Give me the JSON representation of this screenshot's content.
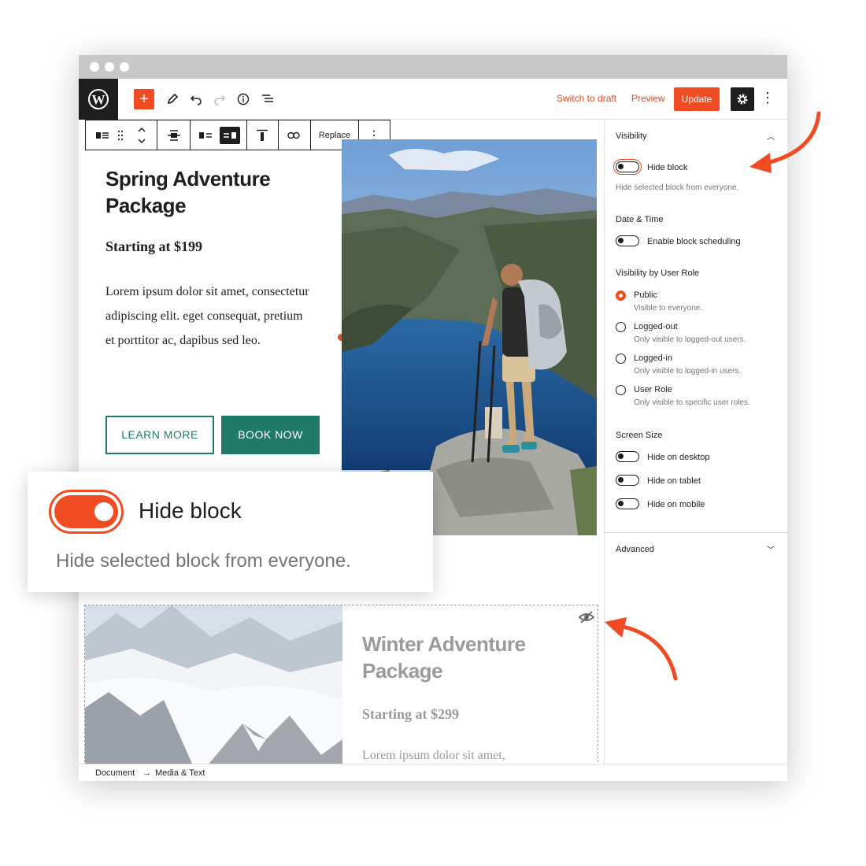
{
  "topbar": {
    "switch_to_draft": "Switch to draft",
    "preview": "Preview",
    "update": "Update",
    "accent": "#f04c23"
  },
  "block_toolbar": {
    "replace": "Replace"
  },
  "content": {
    "title": "Spring Adventure Package",
    "price": "Starting at $199",
    "paragraph": "Lorem ipsum dolor sit amet, consectetur adipiscing elit. eget consequat, pretium et porttitor ac, dapibus sed leo.",
    "learn_more": "LEARN MORE",
    "book_now": "BOOK NOW",
    "button_color": "#1f7a66"
  },
  "hidden_block": {
    "title": "Winter Adventure Package",
    "price": "Starting at $299",
    "paragraph": "Lorem ipsum dolor sit amet,"
  },
  "sidebar": {
    "visibility_heading": "Visibility",
    "hide_block_label": "Hide block",
    "hide_block_help": "Hide selected block from everyone.",
    "date_time_heading": "Date & Time",
    "enable_scheduling_label": "Enable block scheduling",
    "user_role_heading": "Visibility by User Role",
    "roles": [
      {
        "label": "Public",
        "help": "Visible to everyone.",
        "selected": true
      },
      {
        "label": "Logged-out",
        "help": "Only visible to logged-out users.",
        "selected": false
      },
      {
        "label": "Logged-in",
        "help": "Only visible to logged-in users.",
        "selected": false
      },
      {
        "label": "User Role",
        "help": "Only visible to specific user roles.",
        "selected": false
      }
    ],
    "screen_size_heading": "Screen Size",
    "hide_desktop": "Hide on desktop",
    "hide_tablet": "Hide on tablet",
    "hide_mobile": "Hide on mobile",
    "advanced_heading": "Advanced"
  },
  "footer": {
    "crumb_document": "Document",
    "crumb_separator": "→",
    "crumb_block": "Media & Text"
  },
  "callout": {
    "label": "Hide block",
    "help": "Hide selected block from everyone."
  }
}
